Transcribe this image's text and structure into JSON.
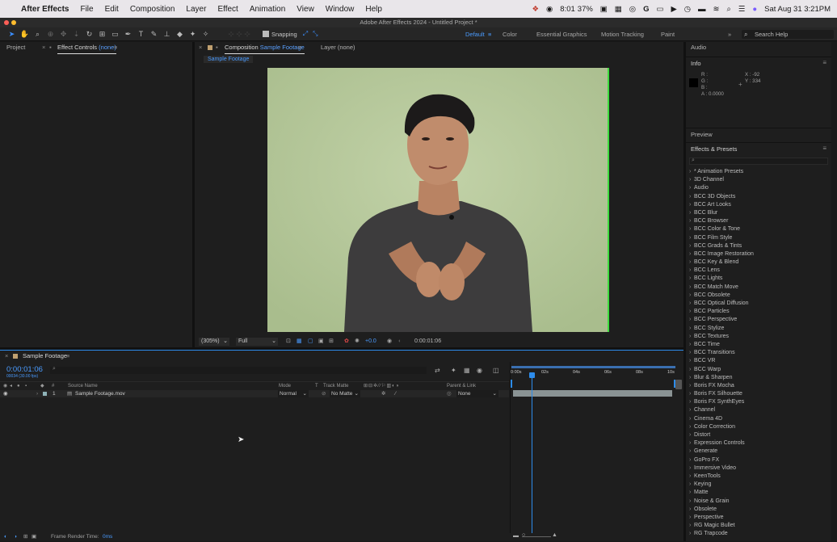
{
  "menubar": {
    "app_name": "After Effects",
    "items": [
      "File",
      "Edit",
      "Composition",
      "Layer",
      "Effect",
      "Animation",
      "View",
      "Window",
      "Help"
    ],
    "timer": "8:01",
    "battery": "37%",
    "datetime": "Sat Aug 31  3:21PM"
  },
  "window": {
    "title": "Adobe After Effects 2024 - Untitled Project *"
  },
  "toolbar": {
    "snapping_label": "Snapping",
    "workspaces": [
      "Default",
      "Color",
      "Essential Graphics",
      "Motion Tracking",
      "Paint"
    ],
    "active_workspace": "Default",
    "search_placeholder": "Search Help"
  },
  "left_panel": {
    "tabs": {
      "project": "Project",
      "effect_controls": "Effect Controls",
      "effect_controls_target": "(none)"
    }
  },
  "composition": {
    "tab_prefix": "Composition",
    "tab_name": "Sample Footage",
    "layer_tab": "Layer (none)",
    "breadcrumb": "Sample Footage",
    "zoom": "(305%)",
    "resolution": "Full",
    "exposure": "+0.0",
    "timecode": "0:00:01:06"
  },
  "right_panel": {
    "audio": "Audio",
    "info": {
      "title": "Info",
      "r": "R :",
      "g": "G :",
      "b": "B :",
      "a": "A : 0.0000",
      "x": "X : -92",
      "y": "Y : 334"
    },
    "preview": "Preview",
    "effects_presets": {
      "title": "Effects & Presets",
      "items": [
        "* Animation Presets",
        "3D Channel",
        "Audio",
        "BCC 3D Objects",
        "BCC Art Looks",
        "BCC Blur",
        "BCC Browser",
        "BCC Color & Tone",
        "BCC Film Style",
        "BCC Grads & Tints",
        "BCC Image Restoration",
        "BCC Key & Blend",
        "BCC Lens",
        "BCC Lights",
        "BCC Match Move",
        "BCC Obsolete",
        "BCC Optical Diffusion",
        "BCC Particles",
        "BCC Perspective",
        "BCC Stylize",
        "BCC Textures",
        "BCC Time",
        "BCC Transitions",
        "BCC VR",
        "BCC Warp",
        "Blur & Sharpen",
        "Boris FX Mocha",
        "Boris FX Silhouette",
        "Boris FX SynthEyes",
        "Channel",
        "Cinema 4D",
        "Color Correction",
        "Distort",
        "Expression Controls",
        "Generate",
        "GoPro FX",
        "Immersive Video",
        "KeenTools",
        "Keying",
        "Matte",
        "Noise & Grain",
        "Obsolete",
        "Perspective",
        "RG Magic Bullet",
        "RG Trapcode"
      ]
    }
  },
  "timeline": {
    "tab_name": "Sample Footage",
    "timecode": "0:00:01:06",
    "sub_timecode": "00034 (30.00 fps)",
    "columns": {
      "num": "#",
      "source": "Source Name",
      "mode": "Mode",
      "t": "T",
      "track_matte": "Track Matte",
      "parent": "Parent & Link"
    },
    "layer": {
      "number": "1",
      "name": "Sample Footage.mov",
      "mode": "Normal",
      "matte": "No Matte",
      "parent": "None"
    },
    "ruler": [
      "0:00s",
      "02s",
      "04s",
      "06s",
      "08s",
      "10s"
    ],
    "frame_render_label": "Frame Render Time:",
    "frame_render_value": "0ms"
  },
  "colors": {
    "accent_blue": "#2d8ceb",
    "chroma_green": "#b7c99c"
  }
}
